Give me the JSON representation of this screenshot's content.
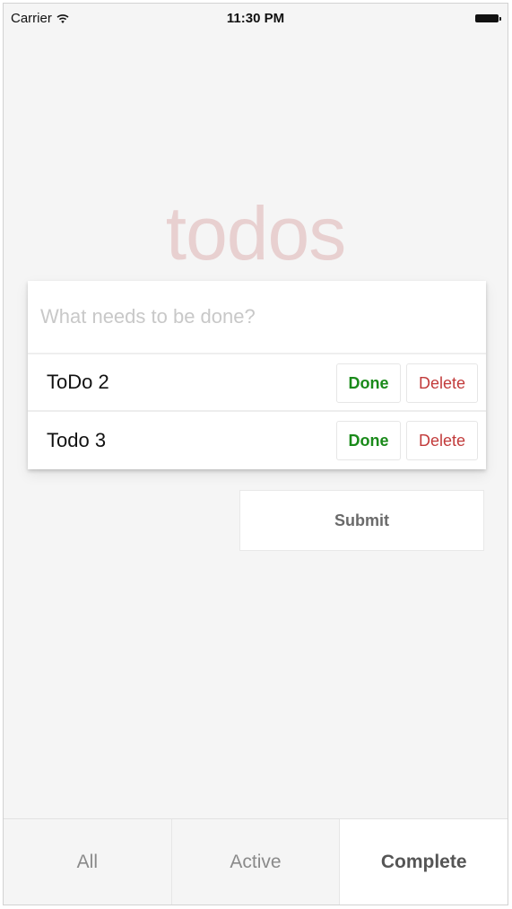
{
  "status_bar": {
    "carrier": "Carrier",
    "time": "11:30 PM",
    "icons": [
      "wifi-icon",
      "battery-icon"
    ]
  },
  "app": {
    "title": "todos",
    "title_color": "#af2f2f"
  },
  "new_todo": {
    "placeholder": "What needs to be done?",
    "value": ""
  },
  "todos": [
    {
      "text": "ToDo 2",
      "done_label": "Done",
      "delete_label": "Delete"
    },
    {
      "text": "Todo 3",
      "done_label": "Done",
      "delete_label": "Delete"
    }
  ],
  "submit": {
    "label": "Submit"
  },
  "filters": {
    "tabs": [
      {
        "label": "All",
        "selected": false
      },
      {
        "label": "Active",
        "selected": false
      },
      {
        "label": "Complete",
        "selected": true
      }
    ]
  },
  "colors": {
    "background": "#f5f5f5",
    "done": "#1a8a1a",
    "delete": "#c23b3b"
  }
}
